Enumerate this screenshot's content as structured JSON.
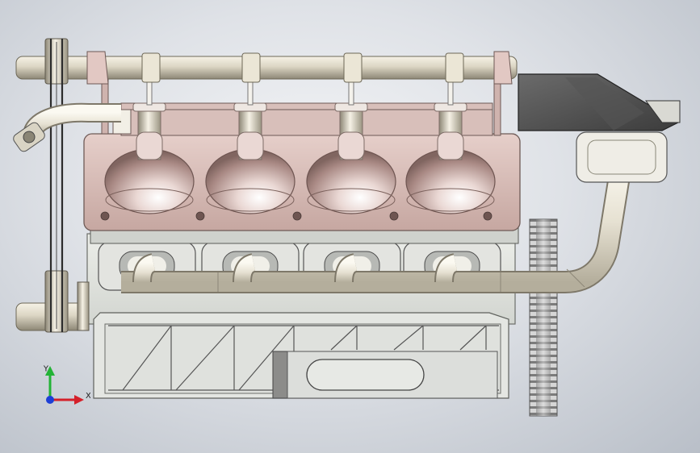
{
  "viewport": {
    "background_top": "#f4f5f7",
    "background_bottom": "#b9bfc8"
  },
  "model": {
    "cylinders": 4,
    "head_color": "#dcc2bd",
    "block_color": "#e3e5e1",
    "pipe_color": "#e9e5d8",
    "cover_color": "#4f4f4f"
  },
  "triad": {
    "x_label": "X",
    "y_label": "Y",
    "x_color": "#d4202a",
    "y_color": "#23b336",
    "z_color": "#1d3fd6"
  }
}
